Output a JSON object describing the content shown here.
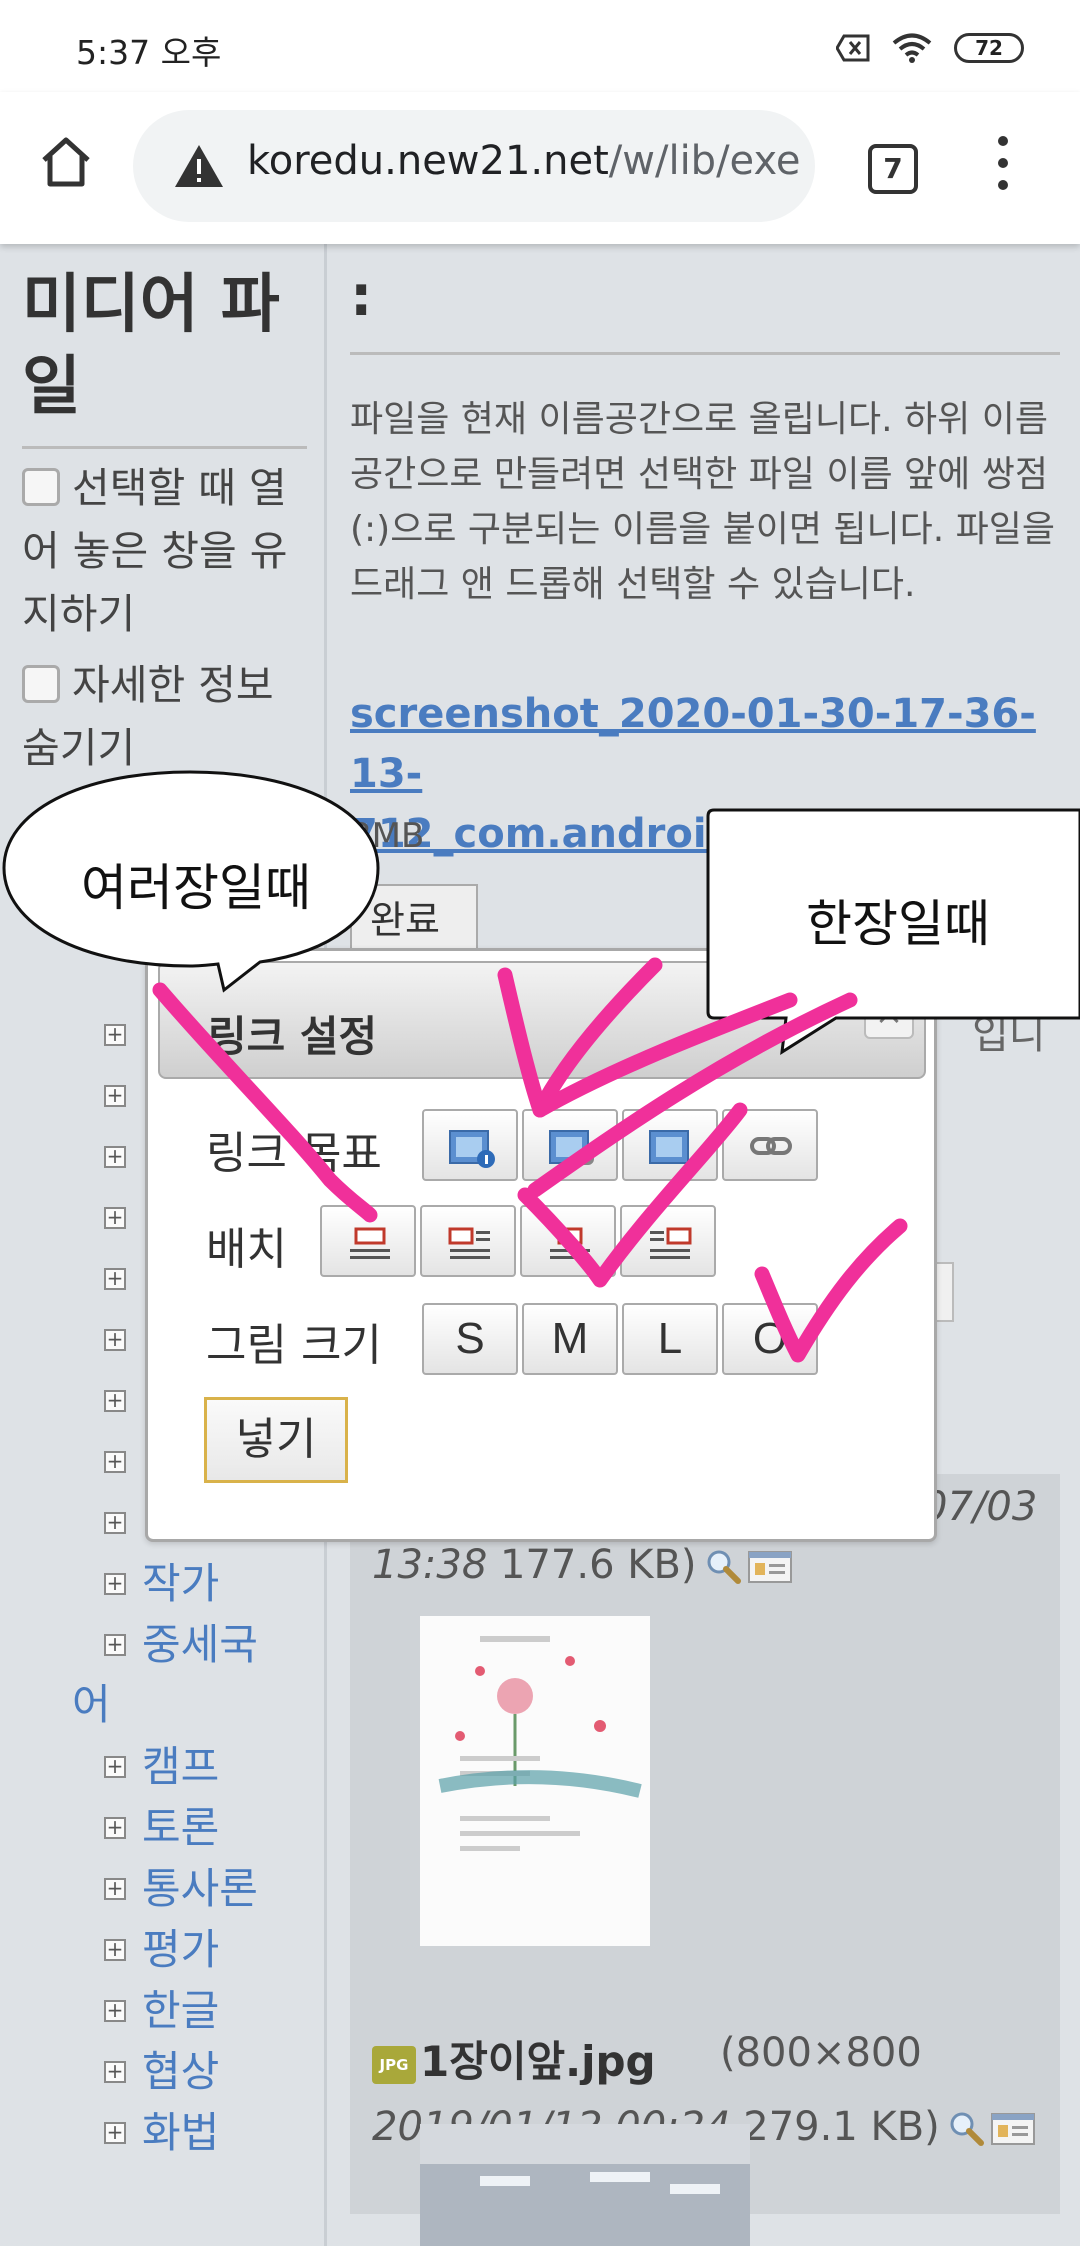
{
  "status_bar": {
    "time": "5:37 오후",
    "battery": "72"
  },
  "browser": {
    "url_host": "koredu.new21.net",
    "url_path": "/w/lib/exe",
    "tab_count": "7"
  },
  "sidebar": {
    "title": "미디어 파일",
    "option_keep_open": "선택할 때 열어 놓은 창을 유지하기",
    "option_hide_details": "자세한 정보 숨기기",
    "tree_items": [
      "작가",
      "중세국",
      "캠프",
      "토론",
      "통사론",
      "평가",
      "한글",
      "협상",
      "화법"
    ],
    "tree_item_wrap": "어"
  },
  "main": {
    "namespace": ":",
    "description": "파일을 현재 이름공간으로 올립니다. 하위 이름공간으로 만들려면 선택한 파일 이름 앞에 쌍점(:)으로 구분되는 이름을 붙이면 됩니다. 파일을 드래그 앤 드롭해 선택할 수 있습니다.",
    "uploaded_file": "screenshot_2020-01-30-17-36-13-712_com.android.chrome.jpg",
    "file_size": "3MB",
    "done_button": "완료",
    "intro_tail": "입니",
    "entry1": {
      "date": "07/03",
      "time": "13:38",
      "size": "177.6 KB)"
    },
    "entry2": {
      "name": "1장이앞.jpg",
      "dimensions": "(800×800",
      "datetime": "2019/01/12 00:24",
      "size": "279.1 KB)"
    },
    "jpg_icon_label": "JPG"
  },
  "dialog": {
    "title": "링크 설정",
    "close": "×",
    "link_target_label": "링크 목표",
    "align_label": "배치",
    "size_label": "그림 크기",
    "size_options": [
      "S",
      "M",
      "L",
      "O"
    ],
    "insert_button": "넣기"
  },
  "annotations": {
    "left_bubble": "여러장일때",
    "right_bubble": "한장일때",
    "pen_color": "#f0309a"
  }
}
